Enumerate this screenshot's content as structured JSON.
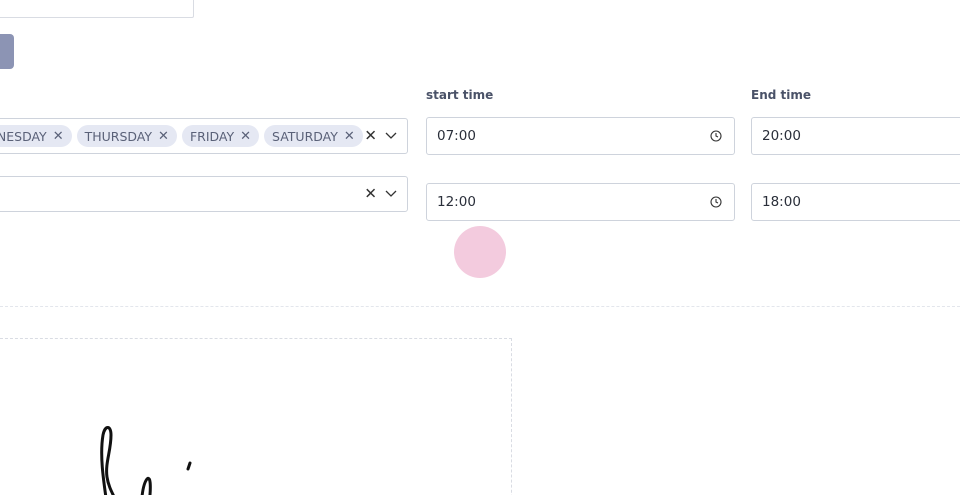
{
  "labels": {
    "start_time": "start time",
    "end_time": "End time"
  },
  "row1": {
    "days": [
      "WEDNESDAY",
      "THURSDAY",
      "FRIDAY",
      "SATURDAY"
    ],
    "start_time": "07:00",
    "end_time": "20:00"
  },
  "row2": {
    "days": [],
    "start_time": "12:00",
    "end_time": "18:00"
  },
  "colors": {
    "chip_bg": "#e5e8f3",
    "button": "#8c94b4",
    "touch_indicator": "#e9a0c3"
  },
  "icons": [
    "chip-remove-icon",
    "clear-icon",
    "chevron-down-icon",
    "clock-icon"
  ]
}
